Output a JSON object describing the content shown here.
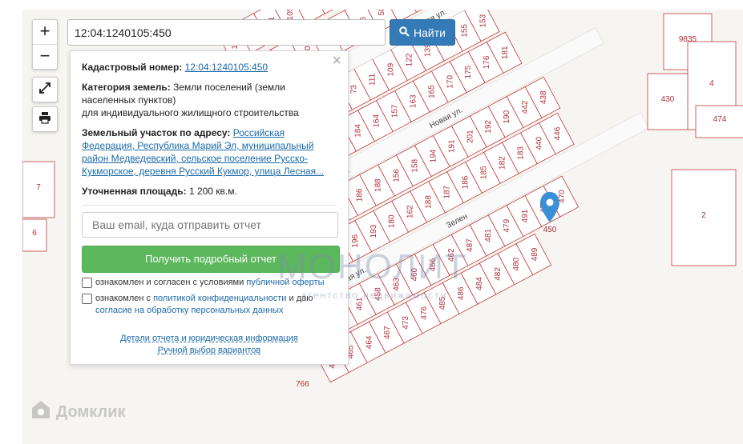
{
  "search": {
    "value": "12:04:1240105:450",
    "button_label": "Найти"
  },
  "zoom": {
    "in": "+",
    "out": "−"
  },
  "panel": {
    "close": "×",
    "cadastral_label": "Кадастровый номер:",
    "cadastral_value": "12:04:1240105:450",
    "category_label": "Категория земель:",
    "category_value": "Земли поселений (земли населенных пунктов)",
    "category_use": "для индивидуального жилищного строительства",
    "address_label": "Земельный участок по адресу:",
    "address_value": "Российская Федерация, Республика Марий Эл, муниципальный район Медведевский, сельское поселение Русско-Кукморское, деревня Русский Кукмор, улица Лесная...",
    "area_label": "Уточненная площадь:",
    "area_value": "1 200 кв.м.",
    "email_placeholder": "Ваш email, куда отправить отчет",
    "get_button": "Получить подробный отчет",
    "consent1_text": "ознакомлен и согласен с условиями ",
    "consent1_link": "публичной оферты",
    "consent2_text": "ознакомлен с ",
    "consent2_link1": "политикой конфиденциальности",
    "consent2_mid": " и даю",
    "consent2_link2": "согласие на обработку персональных данных",
    "details_link": "Детали отчета и юридическая информация",
    "manual_link": "Ручной выбор вариантов"
  },
  "map": {
    "streets": [
      "Новая ул.",
      "Новая ул.",
      "Новая ул.",
      "Новая ул.",
      "Новая ул.",
      "Зелен"
    ],
    "parcels": [
      "115",
      "128",
      "121",
      "105",
      "118",
      "116",
      "108",
      "106",
      "110",
      "64",
      "83",
      "81",
      "96",
      "52",
      "100",
      "125",
      "90",
      "71",
      "44",
      "55",
      "58",
      "59",
      "63",
      "69",
      "88",
      "93",
      "117",
      "124",
      "91",
      "87",
      "113",
      "85",
      "82",
      "73",
      "111",
      "109",
      "122",
      "139",
      "149",
      "155",
      "153",
      "170",
      "148",
      "136",
      "160",
      "158",
      "171",
      "167",
      "166",
      "168",
      "184",
      "164",
      "157",
      "163",
      "165",
      "170",
      "175",
      "176",
      "181",
      "173",
      "172",
      "174",
      "167",
      "160",
      "178",
      "179",
      "190",
      "186",
      "188",
      "156",
      "158",
      "194",
      "191",
      "201",
      "192",
      "190",
      "442",
      "438",
      "431",
      "430",
      "443",
      "449",
      "451",
      "197",
      "196",
      "193",
      "180",
      "162",
      "188",
      "187",
      "186",
      "185",
      "182",
      "183",
      "440",
      "446",
      "452",
      "450",
      "454",
      "456",
      "461",
      "458",
      "463",
      "460",
      "466",
      "462",
      "487",
      "481",
      "479",
      "491",
      "478",
      "470",
      "468",
      "465",
      "464",
      "467",
      "473",
      "476",
      "485",
      "486",
      "484",
      "482",
      "480",
      "489",
      "488",
      "469",
      "459",
      "458",
      "471",
      "457",
      "447",
      "451",
      "453",
      "448",
      "455",
      "150",
      "145",
      "144",
      "159",
      "164",
      "151",
      "115",
      "120",
      "111",
      "101",
      "99",
      "97",
      "135",
      "128",
      "133",
      "146",
      "154",
      "174",
      "166",
      "142",
      "153",
      "152",
      "7",
      "6",
      "2",
      "4",
      "9835",
      "430",
      "474",
      "766"
    ],
    "marker_parcel": "450",
    "map_number": "766"
  },
  "watermarks": {
    "monolit": "МОНОЛИТ",
    "monolit_sub": "агентство недвижимости",
    "domclick": "Домклик"
  },
  "colors": {
    "parcel_stroke": "#c03a3a",
    "marker": "#3a8fd6",
    "button_green": "#5cb85c",
    "button_blue": "#337ab7",
    "link": "#1a6aa8"
  }
}
